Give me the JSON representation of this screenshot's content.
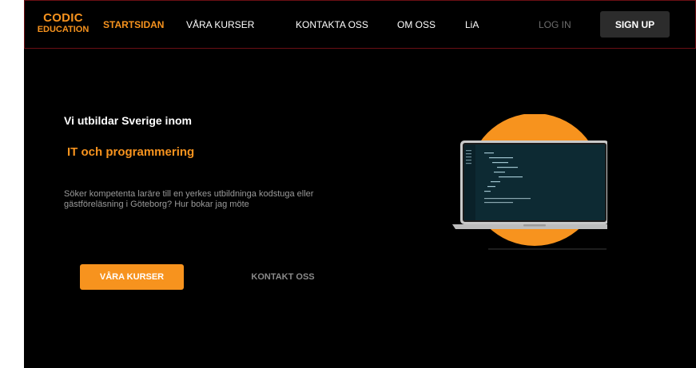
{
  "brand": {
    "line1": "CODIC",
    "line2": "EDUCATION"
  },
  "nav": {
    "items": [
      {
        "label": "STARTSIDAN",
        "active": true
      },
      {
        "label": "VÅRA KURSER",
        "active": false
      },
      {
        "label": "KONTAKTA OSS",
        "active": false
      },
      {
        "label": "OM OSS",
        "active": false
      },
      {
        "label": "LiA",
        "active": false
      }
    ],
    "login_label": "LOG IN",
    "signup_label": "SIGN UP"
  },
  "hero": {
    "title": "Vi utbildar Sverige inom",
    "highlight": "IT och programmering",
    "description": "Söker kompetenta laräre till en yerkes utbildninga kodstuga eller gästföreläsning i Göteborg? Hur bokar jag möte",
    "primary_button": "VÅRA KURSER",
    "secondary_button": "KONTAKT OSS"
  },
  "colors": {
    "accent": "#f7931e",
    "background": "#000000",
    "header_border": "#6b0f14",
    "signup_bg": "#2c2c2c",
    "muted_text": "#9a9a9a"
  },
  "illustration": {
    "name": "laptop-illustration",
    "circle_color": "#f7931e",
    "screen_color": "#0d2a33"
  }
}
